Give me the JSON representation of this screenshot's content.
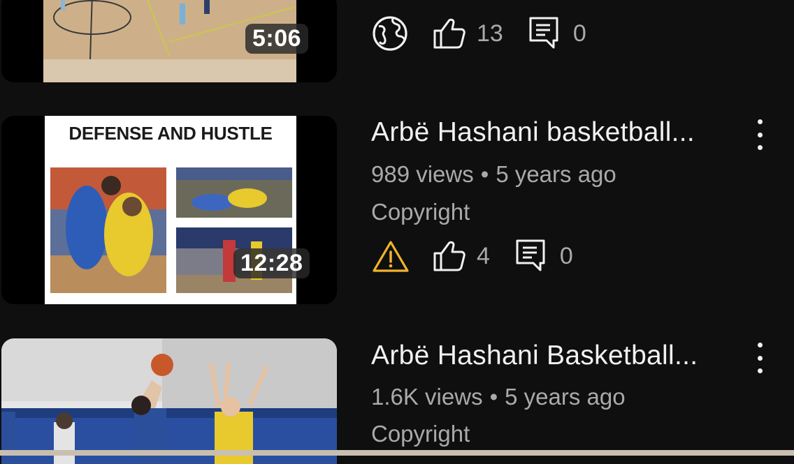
{
  "videos": [
    {
      "duration": "5:06",
      "visibility_icon": "globe-icon",
      "likes": "13",
      "comments": "0"
    },
    {
      "thumbnail_text": "DEFENSE AND HUSTLE",
      "duration": "12:28",
      "title": "Arbë Hashani basketball...",
      "views": "989 views",
      "age": "5 years ago",
      "status": "Copyright",
      "visibility_icon": "warning-icon",
      "likes": "4",
      "comments": "0"
    },
    {
      "title": "Arbë Hashani Basketball...",
      "views": "1.6K views",
      "age": "5 years ago",
      "status": "Copyright"
    }
  ],
  "colors": {
    "background": "#0f0f0f",
    "text_primary": "#f1f1f1",
    "text_secondary": "#aaaaaa",
    "warning": "#f0b429"
  }
}
